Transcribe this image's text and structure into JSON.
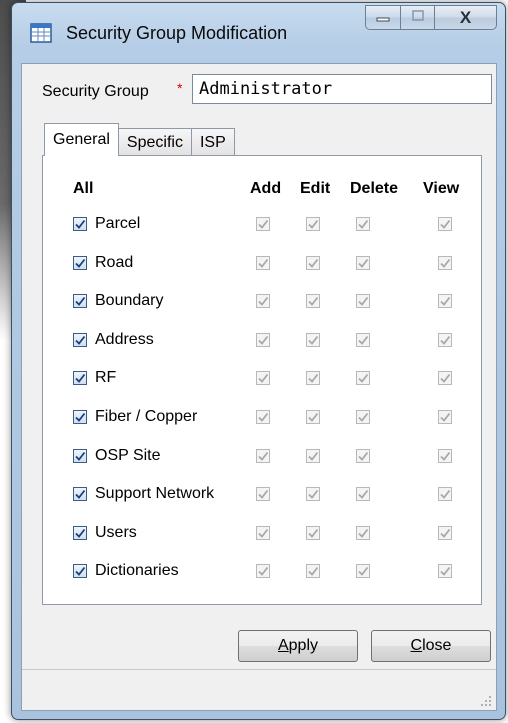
{
  "window": {
    "title": "Security Group Modification",
    "close_glyph": "X"
  },
  "icons": {
    "app": "table-icon",
    "minimize": "minimize-icon",
    "maximize": "maximize-icon",
    "close": "close-icon",
    "check": "check-icon",
    "grip": "resize-grip-icon"
  },
  "form": {
    "security_group_label": "Security Group",
    "required_mark": "*",
    "security_group_value": "Administrator"
  },
  "tabs": [
    {
      "label": "General",
      "active": true
    },
    {
      "label": "Specific",
      "active": false
    },
    {
      "label": "ISP",
      "active": false
    }
  ],
  "grid": {
    "headers": {
      "all": "All",
      "add": "Add",
      "edit": "Edit",
      "delete": "Delete",
      "view": "View"
    },
    "rows": [
      {
        "label": "Parcel"
      },
      {
        "label": "Road"
      },
      {
        "label": "Boundary"
      },
      {
        "label": "Address"
      },
      {
        "label": "RF"
      },
      {
        "label": "Fiber / Copper"
      },
      {
        "label": "OSP Site"
      },
      {
        "label": "Support Network"
      },
      {
        "label": "Users"
      },
      {
        "label": "Dictionaries"
      }
    ]
  },
  "buttons": {
    "apply_pre": "",
    "apply_key": "A",
    "apply_post": "pply",
    "close_pre": "",
    "close_key": "C",
    "close_post": "lose"
  },
  "colors": {
    "required": "#d40000",
    "check_enabled": "#1a3f7a",
    "check_disabled": "#a8a8a8"
  }
}
